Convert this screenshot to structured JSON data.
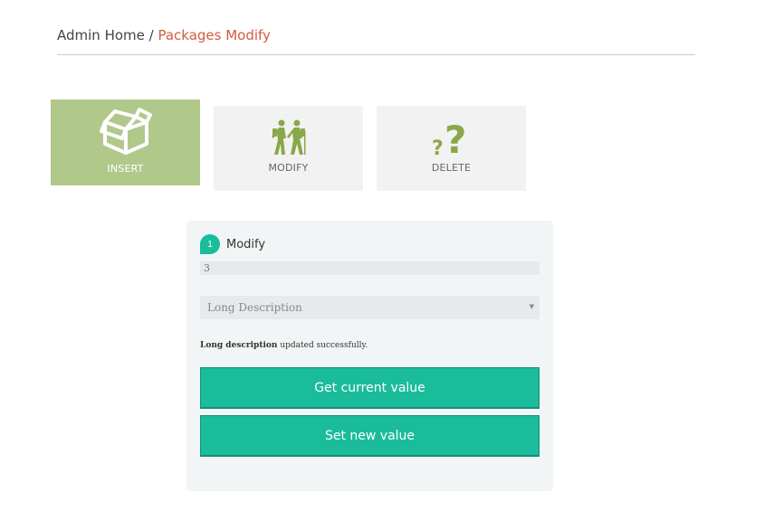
{
  "breadcrumb": {
    "home": "Admin Home",
    "separator": " / ",
    "current": "Packages Modify"
  },
  "tiles": {
    "insert": {
      "label": "INSERT",
      "icon": "open-box-icon"
    },
    "modify": {
      "label": "MODIFY",
      "icon": "hikers-icon"
    },
    "delete": {
      "label": "DELETE",
      "icon": "question-marks-icon"
    }
  },
  "panel": {
    "step_number": "1",
    "step_title": "Modify",
    "id_value": "3",
    "field_select": {
      "selected": "Long Description"
    },
    "status": {
      "field": "Long description",
      "message": " updated successfully."
    },
    "get_button": "Get current value",
    "set_button": "Set new value"
  },
  "colors": {
    "accent": "#1abc9c",
    "insert_tile": "#b1c88b",
    "icon_green": "#8aa84a",
    "breadcrumb_current": "#d35a3c"
  }
}
